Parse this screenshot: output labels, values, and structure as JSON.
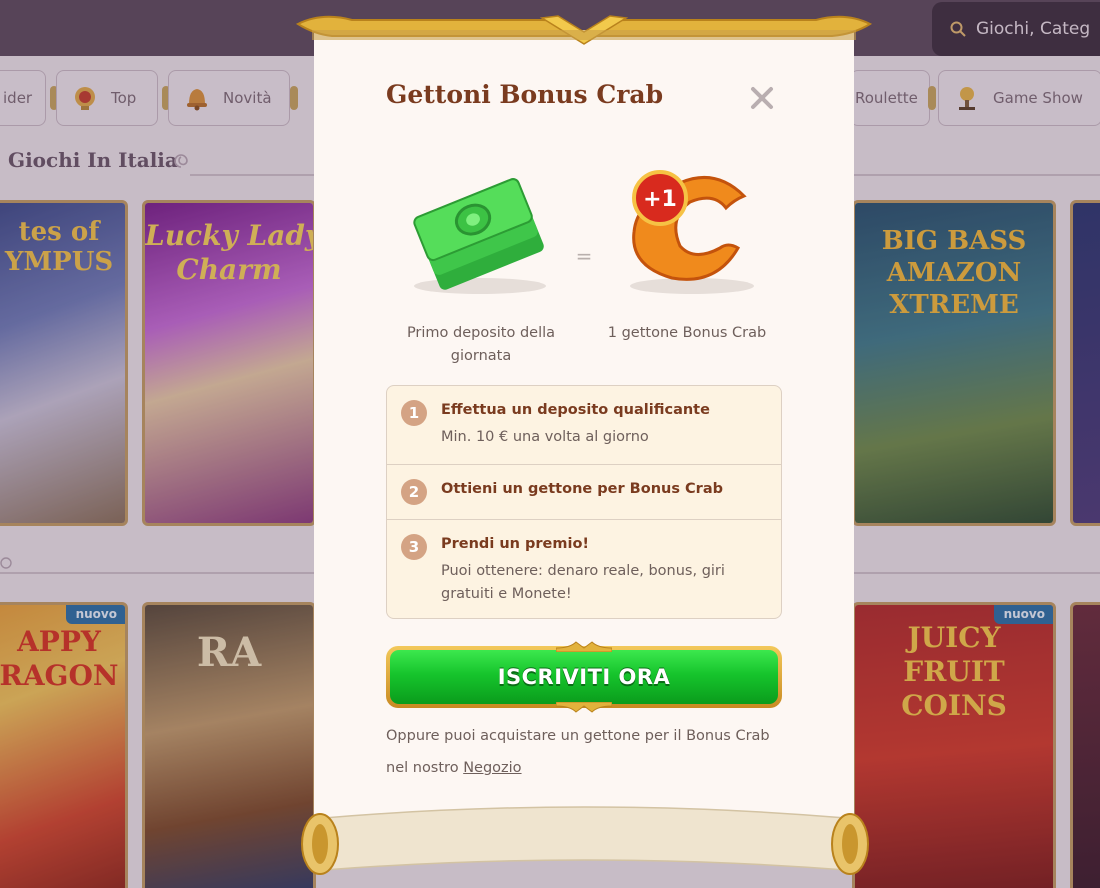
{
  "search": {
    "placeholder": "Giochi, Categ"
  },
  "categories": [
    {
      "label": "ider",
      "icon": "partial-icon"
    },
    {
      "label": "Top",
      "icon": "trophy-icon"
    },
    {
      "label": "Novità",
      "icon": "bell-icon"
    },
    {
      "label": "Roulette",
      "icon": "roulette-icon"
    },
    {
      "label": "Game Show",
      "icon": "game-show-icon"
    }
  ],
  "section": {
    "title": "Giochi In Italia"
  },
  "games": [
    {
      "name": "Gates of Olympus",
      "caption": "tes of\nYMPUS",
      "badge": ""
    },
    {
      "name": "Lucky Lady's Charm deluxe",
      "caption": "Lucky Lady\nCharm",
      "badge": ""
    },
    {
      "name": "Big Bass Amazon Xtreme",
      "caption": "BIG BASS\nAMAZON\nXTREME",
      "badge": ""
    },
    {
      "name": "Happy Dragon",
      "caption": "APPY\nRAGON",
      "badge": "nuovo"
    },
    {
      "name": "Land of Ra",
      "caption": "RA",
      "badge": ""
    },
    {
      "name": "Juicy Fruit Coins",
      "caption": "JUICY\nFRUIT\nCOINS",
      "badge": "nuovo"
    }
  ],
  "modal": {
    "title": "Gettoni Bonus Crab",
    "close_icon": "close-icon",
    "equals": "=",
    "left_caption": "Primo deposito della giornata",
    "right_caption": "1 gettone Bonus Crab",
    "claw_badge": "+1",
    "steps": [
      {
        "num": "1",
        "head": "Effettua un deposito qualificante",
        "body": "Min. 10 € una volta al giorno"
      },
      {
        "num": "2",
        "head": "Ottieni un gettone per Bonus Crab",
        "body": ""
      },
      {
        "num": "3",
        "head": "Prendi un premio!",
        "body": "Puoi ottenere: denaro reale, bonus, giri gratuiti e Monete!"
      }
    ],
    "cta_label": "ISCRIVITI ORA",
    "footnote": "Oppure puoi acquistare un gettone per il Bonus Crab nel nostro",
    "footnote_link": "Negozio"
  },
  "colors": {
    "accent_green": "#16c42c",
    "title_brown": "#7a3b1f",
    "gold": "#c6a35e"
  }
}
